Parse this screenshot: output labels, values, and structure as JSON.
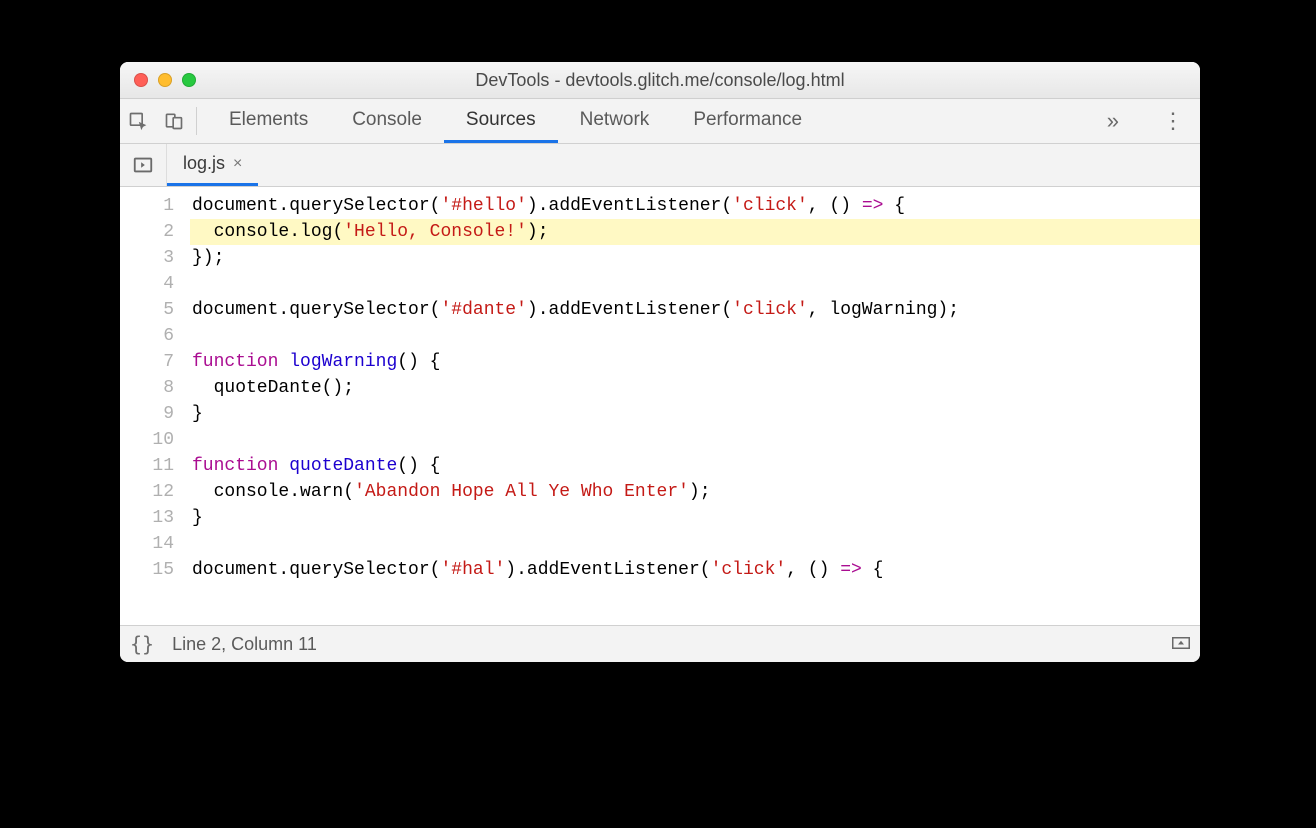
{
  "window": {
    "title": "DevTools - devtools.glitch.me/console/log.html"
  },
  "panels": {
    "items": [
      "Elements",
      "Console",
      "Sources",
      "Network",
      "Performance"
    ],
    "active_index": 2,
    "overflow_glyph": "»"
  },
  "file_tab": {
    "name": "log.js",
    "close_glyph": "×"
  },
  "code": {
    "highlight_line": 2,
    "lines": [
      {
        "n": 1,
        "tokens": [
          {
            "t": "document",
            "c": "t-default"
          },
          {
            "t": ".",
            "c": "t-punct"
          },
          {
            "t": "querySelector",
            "c": "t-method"
          },
          {
            "t": "(",
            "c": "t-punct"
          },
          {
            "t": "'#hello'",
            "c": "t-string"
          },
          {
            "t": ")",
            "c": "t-punct"
          },
          {
            "t": ".",
            "c": "t-punct"
          },
          {
            "t": "addEventListener",
            "c": "t-method"
          },
          {
            "t": "(",
            "c": "t-punct"
          },
          {
            "t": "'click'",
            "c": "t-string"
          },
          {
            "t": ", () ",
            "c": "t-default"
          },
          {
            "t": "=>",
            "c": "t-keyword"
          },
          {
            "t": " {",
            "c": "t-punct"
          }
        ]
      },
      {
        "n": 2,
        "tokens": [
          {
            "t": "  console",
            "c": "t-default"
          },
          {
            "t": ".",
            "c": "t-punct"
          },
          {
            "t": "log",
            "c": "t-method"
          },
          {
            "t": "(",
            "c": "t-punct"
          },
          {
            "t": "'Hello, Console!'",
            "c": "t-string"
          },
          {
            "t": ");",
            "c": "t-punct"
          }
        ]
      },
      {
        "n": 3,
        "tokens": [
          {
            "t": "});",
            "c": "t-punct"
          }
        ]
      },
      {
        "n": 4,
        "tokens": [
          {
            "t": "",
            "c": "t-default"
          }
        ]
      },
      {
        "n": 5,
        "tokens": [
          {
            "t": "document",
            "c": "t-default"
          },
          {
            "t": ".",
            "c": "t-punct"
          },
          {
            "t": "querySelector",
            "c": "t-method"
          },
          {
            "t": "(",
            "c": "t-punct"
          },
          {
            "t": "'#dante'",
            "c": "t-string"
          },
          {
            "t": ")",
            "c": "t-punct"
          },
          {
            "t": ".",
            "c": "t-punct"
          },
          {
            "t": "addEventListener",
            "c": "t-method"
          },
          {
            "t": "(",
            "c": "t-punct"
          },
          {
            "t": "'click'",
            "c": "t-string"
          },
          {
            "t": ", logWarning);",
            "c": "t-default"
          }
        ]
      },
      {
        "n": 6,
        "tokens": [
          {
            "t": "",
            "c": "t-default"
          }
        ]
      },
      {
        "n": 7,
        "tokens": [
          {
            "t": "function",
            "c": "t-keyword"
          },
          {
            "t": " ",
            "c": "t-default"
          },
          {
            "t": "logWarning",
            "c": "t-funcname"
          },
          {
            "t": "() {",
            "c": "t-punct"
          }
        ]
      },
      {
        "n": 8,
        "tokens": [
          {
            "t": "  quoteDante",
            "c": "t-default"
          },
          {
            "t": "();",
            "c": "t-punct"
          }
        ]
      },
      {
        "n": 9,
        "tokens": [
          {
            "t": "}",
            "c": "t-punct"
          }
        ]
      },
      {
        "n": 10,
        "tokens": [
          {
            "t": "",
            "c": "t-default"
          }
        ]
      },
      {
        "n": 11,
        "tokens": [
          {
            "t": "function",
            "c": "t-keyword"
          },
          {
            "t": " ",
            "c": "t-default"
          },
          {
            "t": "quoteDante",
            "c": "t-funcname"
          },
          {
            "t": "() {",
            "c": "t-punct"
          }
        ]
      },
      {
        "n": 12,
        "tokens": [
          {
            "t": "  console",
            "c": "t-default"
          },
          {
            "t": ".",
            "c": "t-punct"
          },
          {
            "t": "warn",
            "c": "t-method"
          },
          {
            "t": "(",
            "c": "t-punct"
          },
          {
            "t": "'Abandon Hope All Ye Who Enter'",
            "c": "t-string"
          },
          {
            "t": ");",
            "c": "t-punct"
          }
        ]
      },
      {
        "n": 13,
        "tokens": [
          {
            "t": "}",
            "c": "t-punct"
          }
        ]
      },
      {
        "n": 14,
        "tokens": [
          {
            "t": "",
            "c": "t-default"
          }
        ]
      },
      {
        "n": 15,
        "tokens": [
          {
            "t": "document",
            "c": "t-default"
          },
          {
            "t": ".",
            "c": "t-punct"
          },
          {
            "t": "querySelector",
            "c": "t-method"
          },
          {
            "t": "(",
            "c": "t-punct"
          },
          {
            "t": "'#hal'",
            "c": "t-string"
          },
          {
            "t": ")",
            "c": "t-punct"
          },
          {
            "t": ".",
            "c": "t-punct"
          },
          {
            "t": "addEventListener",
            "c": "t-method"
          },
          {
            "t": "(",
            "c": "t-punct"
          },
          {
            "t": "'click'",
            "c": "t-string"
          },
          {
            "t": ", () ",
            "c": "t-default"
          },
          {
            "t": "=>",
            "c": "t-keyword"
          },
          {
            "t": " {",
            "c": "t-punct"
          }
        ]
      }
    ]
  },
  "status": {
    "braces": "{}",
    "position": "Line 2, Column 11"
  }
}
